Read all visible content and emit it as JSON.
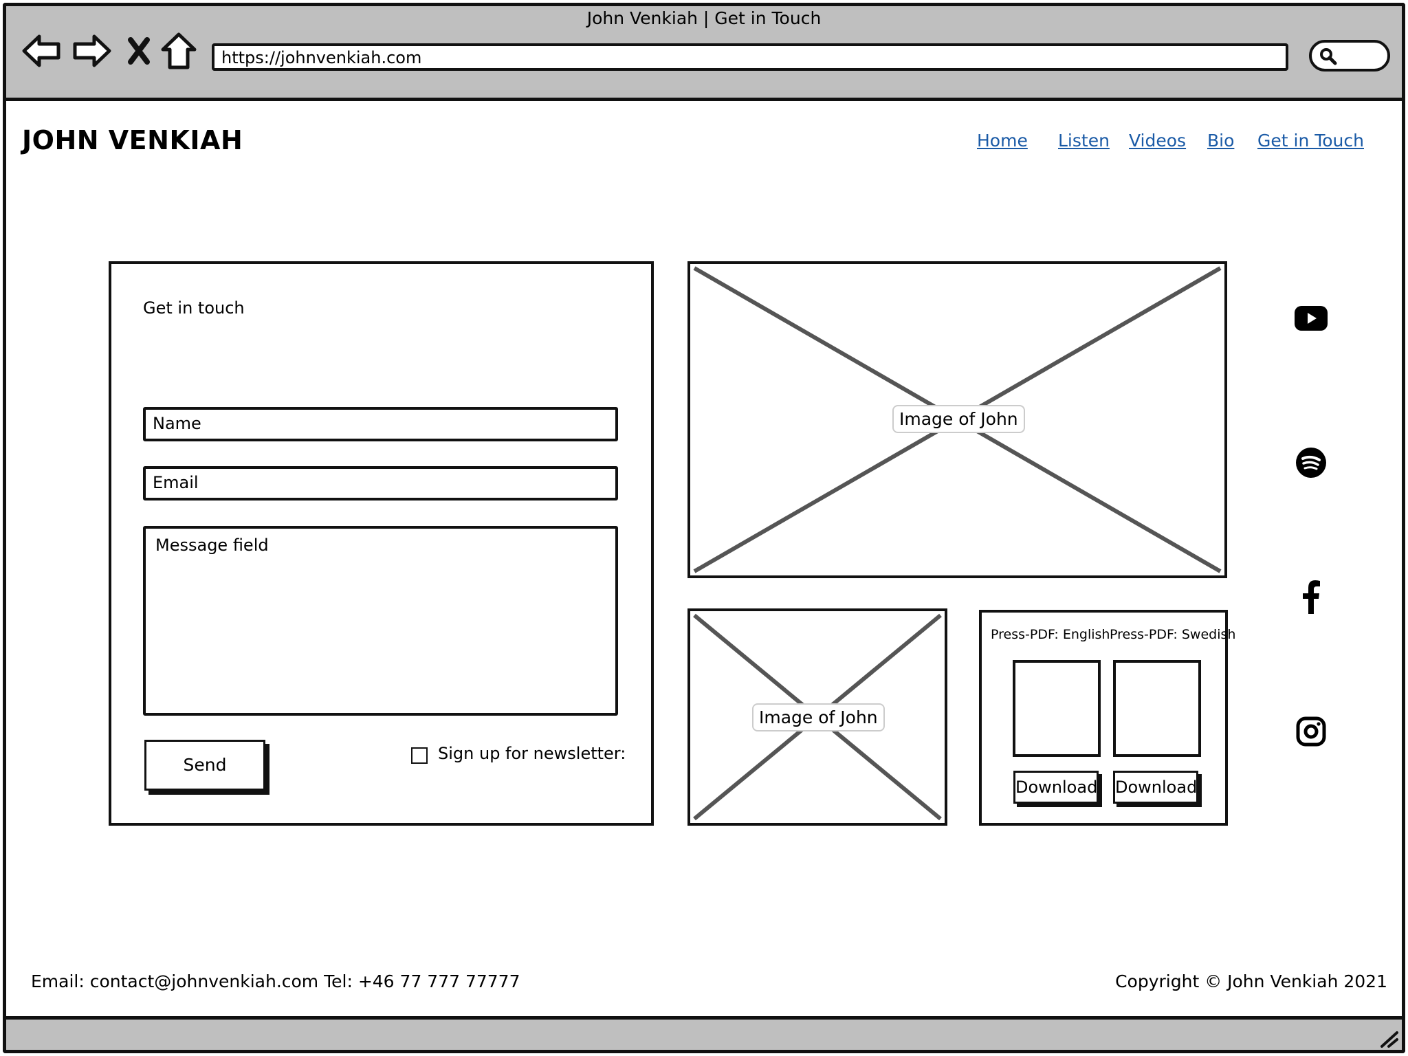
{
  "browser": {
    "window_title": "John Venkiah | Get in Touch",
    "url": "https://johnvenkiah.com",
    "icons": [
      "back-arrow-icon",
      "forward-arrow-icon",
      "stop-x-icon",
      "home-icon",
      "search-icon",
      "resize-grip-icon"
    ]
  },
  "site": {
    "logo": "JOHN VENKIAH",
    "nav": [
      "Home",
      "Listen",
      "Videos",
      "Bio",
      "Get in Touch"
    ],
    "link_color": "#1a5aa6"
  },
  "form": {
    "heading": "Get in touch",
    "name_placeholder": "Name",
    "email_placeholder": "Email",
    "message_placeholder": "Message field",
    "send_label": "Send",
    "newsletter_label": "Sign up for newsletter:"
  },
  "images": {
    "large_label": "Image of John",
    "small_label": "Image of John"
  },
  "press": {
    "english_label": "Press-PDF: English",
    "swedish_label": "Press-PDF: Swedish",
    "download_label": "Download"
  },
  "social": [
    "youtube-icon",
    "spotify-icon",
    "facebook-icon",
    "instagram-icon"
  ],
  "footer": {
    "contact": "Email: contact@johnvenkiah.com Tel: +46 77 777 77777",
    "copyright": "Copyright © John Venkiah 2021"
  }
}
